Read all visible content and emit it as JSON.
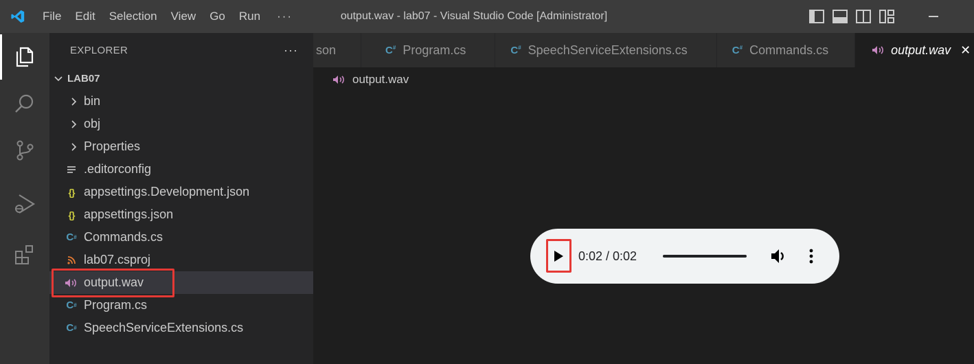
{
  "titlebar": {
    "menu": [
      "File",
      "Edit",
      "Selection",
      "View",
      "Go",
      "Run",
      "···"
    ],
    "window_title": "output.wav - lab07 - Visual Studio Code [Administrator]"
  },
  "activity_bar": {
    "items": [
      "explorer-icon",
      "search-icon",
      "source-control-icon",
      "run-debug-icon",
      "extensions-icon"
    ],
    "active": "explorer-icon"
  },
  "sidebar": {
    "title": "EXPLORER",
    "more": "···",
    "root": "LAB07",
    "items": [
      {
        "label": "bin",
        "icon": "chevron-right-icon"
      },
      {
        "label": "obj",
        "icon": "chevron-right-icon"
      },
      {
        "label": "Properties",
        "icon": "chevron-right-icon"
      },
      {
        "label": ".editorconfig",
        "icon": "lines-icon"
      },
      {
        "label": "appsettings.Development.json",
        "icon": "json-icon"
      },
      {
        "label": "appsettings.json",
        "icon": "json-icon"
      },
      {
        "label": "Commands.cs",
        "icon": "csharp-icon"
      },
      {
        "label": "lab07.csproj",
        "icon": "rss-icon"
      },
      {
        "label": "output.wav",
        "icon": "audio-icon",
        "selected": true
      },
      {
        "label": "Program.cs",
        "icon": "csharp-icon"
      },
      {
        "label": "SpeechServiceExtensions.cs",
        "icon": "csharp-icon"
      }
    ]
  },
  "tabs": [
    {
      "label": "son",
      "icon": ""
    },
    {
      "label": "Program.cs",
      "icon": "C#"
    },
    {
      "label": "SpeechServiceExtensions.cs",
      "icon": "C#"
    },
    {
      "label": "Commands.cs",
      "icon": "C#"
    },
    {
      "label": "output.wav",
      "icon": "audio-icon",
      "active": true
    }
  ],
  "breadcrumb": {
    "label": "output.wav"
  },
  "player": {
    "time": "0:02 / 0:02",
    "progress": 1.0
  },
  "colors": {
    "accent_highlight": "#e53935",
    "csharp": "#519aba",
    "json": "#cbcb41",
    "audio": "#c586c0"
  }
}
